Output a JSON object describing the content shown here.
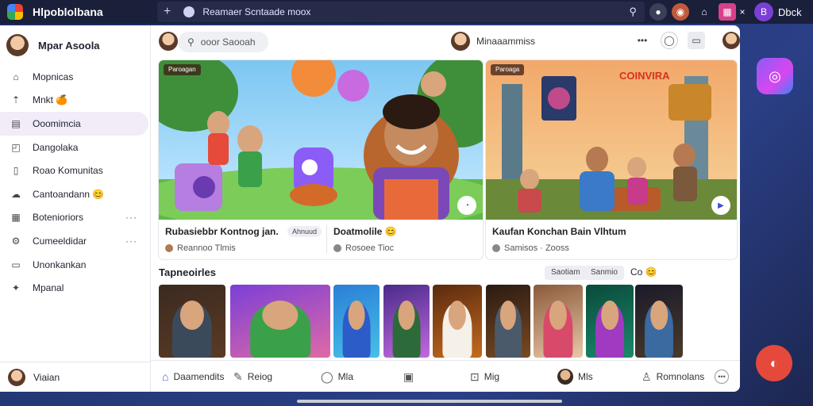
{
  "topbar": {
    "app_title": "Hlpoblolbana",
    "url": "Reamaer Scntaade  moox",
    "book_label": "Dbck",
    "book_glyph": "B"
  },
  "sidebar": {
    "profile_name": "Mpar Asoola",
    "items": [
      {
        "label": "Mopnicas",
        "icon": "home-icon"
      },
      {
        "label": "Mnkt 🍊",
        "icon": "trending-icon"
      },
      {
        "label": "Ooomimcia",
        "icon": "subscriptions-icon",
        "active": true
      },
      {
        "label": "Dangolaka",
        "icon": "library-icon"
      },
      {
        "label": "Roao Komunitas",
        "icon": "community-icon"
      },
      {
        "label": "Cantoandann 😊",
        "icon": "chat-icon"
      },
      {
        "label": "Botenioriors",
        "icon": "grid-icon",
        "more": true
      },
      {
        "label": "Cumeeldidar",
        "icon": "settings-icon",
        "more": true
      },
      {
        "label": "Unonkankan",
        "icon": "bookmark-icon"
      },
      {
        "label": "Mpanal",
        "icon": "help-icon"
      }
    ],
    "footer_label": "Viaian"
  },
  "header": {
    "search_placeholder": "ooor Saooah",
    "channel_name": "Minaaammiss",
    "more": "•••"
  },
  "cards": [
    {
      "tag": "Paroagan",
      "title": "Rubasiebbr Kontnog jan.",
      "chip": "Ahnuud",
      "sub": "Reannoo Tlmis",
      "title2": "Doatmolile 😊",
      "sub2": "Rosoee Tioc"
    },
    {
      "tag": "Paroaga",
      "banner": "COINVIRA",
      "title": "Kaufan Konchan Bain Vlhtum",
      "sub": "Samisos · Zooss"
    }
  ],
  "section": {
    "title": "Tapneoirles",
    "filters": [
      "Saotiam",
      "Sanmio",
      "Co 😊"
    ]
  },
  "tiles": [
    {
      "color_a": "#3b2a20",
      "color_b": "#5a3a24",
      "shirt": "#3a4a5a"
    },
    {
      "color_a": "#7b3fd6",
      "color_b": "#e06aa6",
      "shirt": "#3aa14a"
    },
    {
      "color_a": "#2a7fd6",
      "color_b": "#48c0e8",
      "shirt": "#2b5cc8"
    },
    {
      "color_a": "#4a2a8a",
      "color_b": "#c26ae0",
      "shirt": "#2d6a3a"
    },
    {
      "color_a": "#5a2a10",
      "color_b": "#c46a1c",
      "shirt": "#f5f0e8"
    },
    {
      "color_a": "#2a1a12",
      "color_b": "#7a4a22",
      "shirt": "#4a5a6a"
    },
    {
      "color_a": "#8a5a3a",
      "color_b": "#e8c8a8",
      "shirt": "#d84a6a"
    },
    {
      "color_a": "#0a4a3a",
      "color_b": "#1a8a6a",
      "shirt": "#a03ac0"
    },
    {
      "color_a": "#1a1a2a",
      "color_b": "#4a3a2a",
      "shirt": "#3a6aa0"
    }
  ],
  "tabbar": {
    "tabs": [
      {
        "label": "Daamendits",
        "icon": "home-icon"
      },
      {
        "label": "Reiog",
        "icon": "explore-icon"
      },
      {
        "label": "Mla",
        "icon": "comment-icon"
      },
      {
        "label": "",
        "icon": "square-icon"
      },
      {
        "label": "Mig",
        "icon": "gallery-icon"
      },
      {
        "label": "Mls",
        "icon": "avatar"
      },
      {
        "label": "Romnolans",
        "icon": "people-icon"
      },
      {
        "label": "",
        "icon": "dots-icon"
      }
    ]
  },
  "colors": {
    "accent": "#7b3fd6",
    "active_nav": "#f1ecf7",
    "fab_red": "#e4493b"
  }
}
